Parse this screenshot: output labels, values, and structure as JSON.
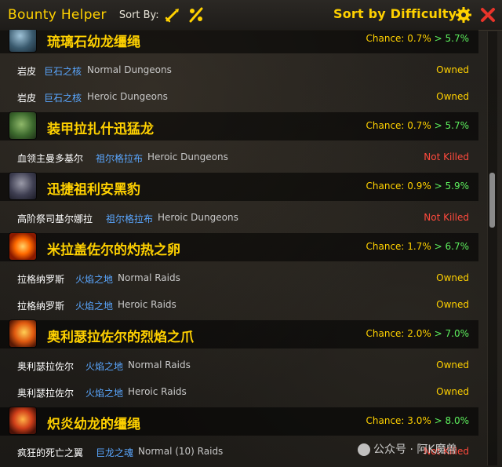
{
  "header": {
    "title": "Bounty Helper",
    "sort_by_label": "Sort By:",
    "sort_button_label": "Sort by Difficulty",
    "icons": [
      "sword-icon",
      "percent-icon",
      "gear-icon",
      "close-icon"
    ]
  },
  "colors": {
    "title_yellow": "#ffd100",
    "chance_green": "#5df05d",
    "zone_blue": "#5aa7ff",
    "not_killed_red": "#ff4a3d",
    "close_red": "#e8342a"
  },
  "mounts": [
    {
      "name": "琉璃石幼龙缰绳",
      "icon": "drake-icon",
      "chance_prefix": "Chance: 0.7%",
      "chance_gt": ">",
      "chance_target": "5.7%",
      "sources": [
        {
          "boss": "岩皮",
          "zone": "巨石之核",
          "difficulty": "Normal Dungeons",
          "status": "Owned"
        },
        {
          "boss": "岩皮",
          "zone": "巨石之核",
          "difficulty": "Heroic Dungeons",
          "status": "Owned"
        }
      ]
    },
    {
      "name": "装甲拉扎什迅猛龙",
      "icon": "raptor-icon",
      "chance_prefix": "Chance: 0.7%",
      "chance_gt": ">",
      "chance_target": "5.7%",
      "sources": [
        {
          "boss": "血领主曼多基尔",
          "zone": "祖尔格拉布",
          "difficulty": "Heroic Dungeons",
          "status": "Not Killed"
        }
      ]
    },
    {
      "name": "迅捷祖利安黑豹",
      "icon": "panther-icon",
      "chance_prefix": "Chance: 0.9%",
      "chance_gt": ">",
      "chance_target": "5.9%",
      "sources": [
        {
          "boss": "高阶祭司基尔娜拉",
          "zone": "祖尔格拉布",
          "difficulty": "Heroic Dungeons",
          "status": "Not Killed"
        }
      ]
    },
    {
      "name": "米拉盖佐尔的灼热之卵",
      "icon": "fire-egg-icon",
      "chance_prefix": "Chance: 1.7%",
      "chance_gt": ">",
      "chance_target": "6.7%",
      "sources": [
        {
          "boss": "拉格纳罗斯",
          "zone": "火焰之地",
          "difficulty": "Normal Raids",
          "status": "Owned"
        },
        {
          "boss": "拉格纳罗斯",
          "zone": "火焰之地",
          "difficulty": "Heroic Raids",
          "status": "Owned"
        }
      ]
    },
    {
      "name": "奥利瑟拉佐尔的烈焰之爪",
      "icon": "fire-hawk-icon",
      "chance_prefix": "Chance: 2.0%",
      "chance_gt": ">",
      "chance_target": "7.0%",
      "sources": [
        {
          "boss": "奥利瑟拉佐尔",
          "zone": "火焰之地",
          "difficulty": "Normal Raids",
          "status": "Owned"
        },
        {
          "boss": "奥利瑟拉佐尔",
          "zone": "火焰之地",
          "difficulty": "Heroic Raids",
          "status": "Owned"
        }
      ]
    },
    {
      "name": "炽炎幼龙的缰绳",
      "icon": "blazing-drake-icon",
      "chance_prefix": "Chance: 3.0%",
      "chance_gt": ">",
      "chance_target": "8.0%",
      "sources": [
        {
          "boss": "疯狂的死亡之翼",
          "zone": "巨龙之魂",
          "difficulty": "Normal (10) Raids",
          "status": "Not Killed"
        }
      ]
    }
  ],
  "watermark": "公众号 · 阿K魔兽"
}
